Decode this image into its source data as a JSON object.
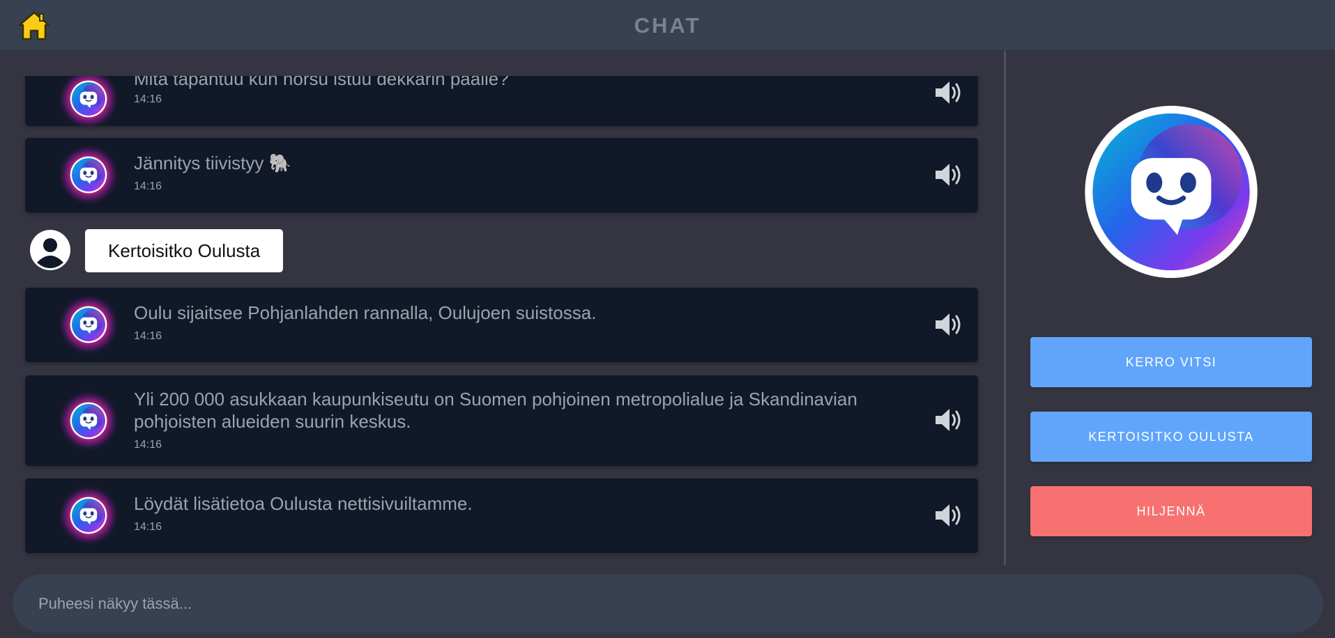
{
  "header": {
    "title": "CHAT",
    "home_icon": "home-icon",
    "home_color": "#facc15"
  },
  "messages": [
    {
      "sender": "bot",
      "text": "Mitä tapahtuu kun norsu istuu dekkarin päälle?",
      "time": "14:16"
    },
    {
      "sender": "bot",
      "text": "Jännitys tiivistyy 🐘",
      "time": "14:16"
    },
    {
      "sender": "user",
      "text": "Kertoisitko Oulusta"
    },
    {
      "sender": "bot",
      "text": "Oulu sijaitsee Pohjanlahden rannalla, Oulujoen suistossa.",
      "time": "14:16"
    },
    {
      "sender": "bot",
      "text": "Yli 200 000 asukkaan kaupunkiseutu on Suomen pohjoinen metropolialue ja Skandinavian pohjoisten alueiden suurin keskus.",
      "time": "14:16"
    },
    {
      "sender": "bot",
      "text": "Löydät lisätietoa Oulusta nettisivuiltamme.",
      "time": "14:16"
    }
  ],
  "sidebar": {
    "joke_button": "KERRO VITSI",
    "oulu_button": "KERTOISITKO OULUSTA",
    "mute_button": "HILJENNÄ"
  },
  "input": {
    "placeholder": "Puheesi näkyy tässä...",
    "value": ""
  },
  "colors": {
    "header_bg": "#374151",
    "page_bg": "#353541",
    "bot_bubble": "#111827",
    "user_bubble": "#ffffff",
    "blue_button": "#60a5fa",
    "red_button": "#f87171"
  }
}
